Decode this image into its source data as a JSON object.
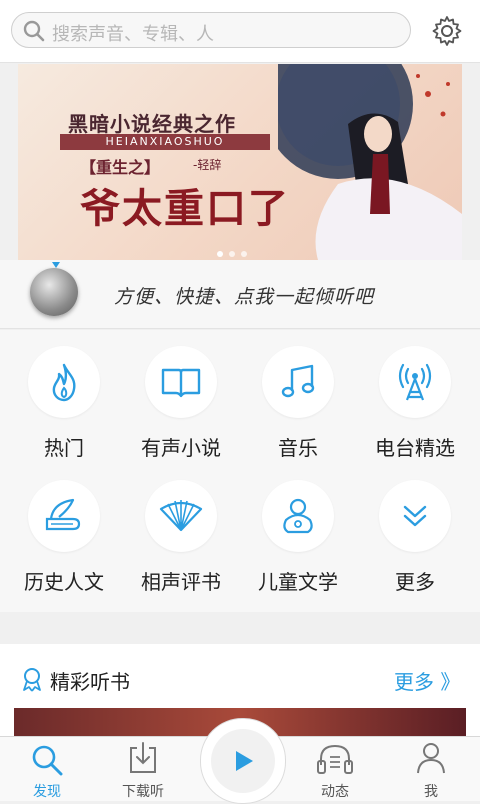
{
  "search": {
    "placeholder": "搜索声音、专辑、人"
  },
  "banner": {
    "title": "黑暗小说经典之作",
    "pinyin": "HEIANXIAOSHUO",
    "book": "【重生之】",
    "author": "-轻辞",
    "headline": "爷太重口了"
  },
  "listen": {
    "text": "方便、快捷、点我一起倾听吧"
  },
  "categories": [
    {
      "label": "热门",
      "icon": "flame-icon"
    },
    {
      "label": "有声小说",
      "icon": "book-icon"
    },
    {
      "label": "音乐",
      "icon": "music-note-icon"
    },
    {
      "label": "电台精选",
      "icon": "radio-tower-icon"
    },
    {
      "label": "历史人文",
      "icon": "quill-book-icon"
    },
    {
      "label": "相声评书",
      "icon": "folding-fan-icon"
    },
    {
      "label": "儿童文学",
      "icon": "baby-icon"
    },
    {
      "label": "更多",
      "icon": "chevron-double-down-icon"
    }
  ],
  "section": {
    "title": "精彩听书",
    "more": "更多 》"
  },
  "nav": {
    "discover": "发现",
    "download": "下载听",
    "feed": "动态",
    "me": "我"
  },
  "colors": {
    "accent": "#2b9de0"
  }
}
